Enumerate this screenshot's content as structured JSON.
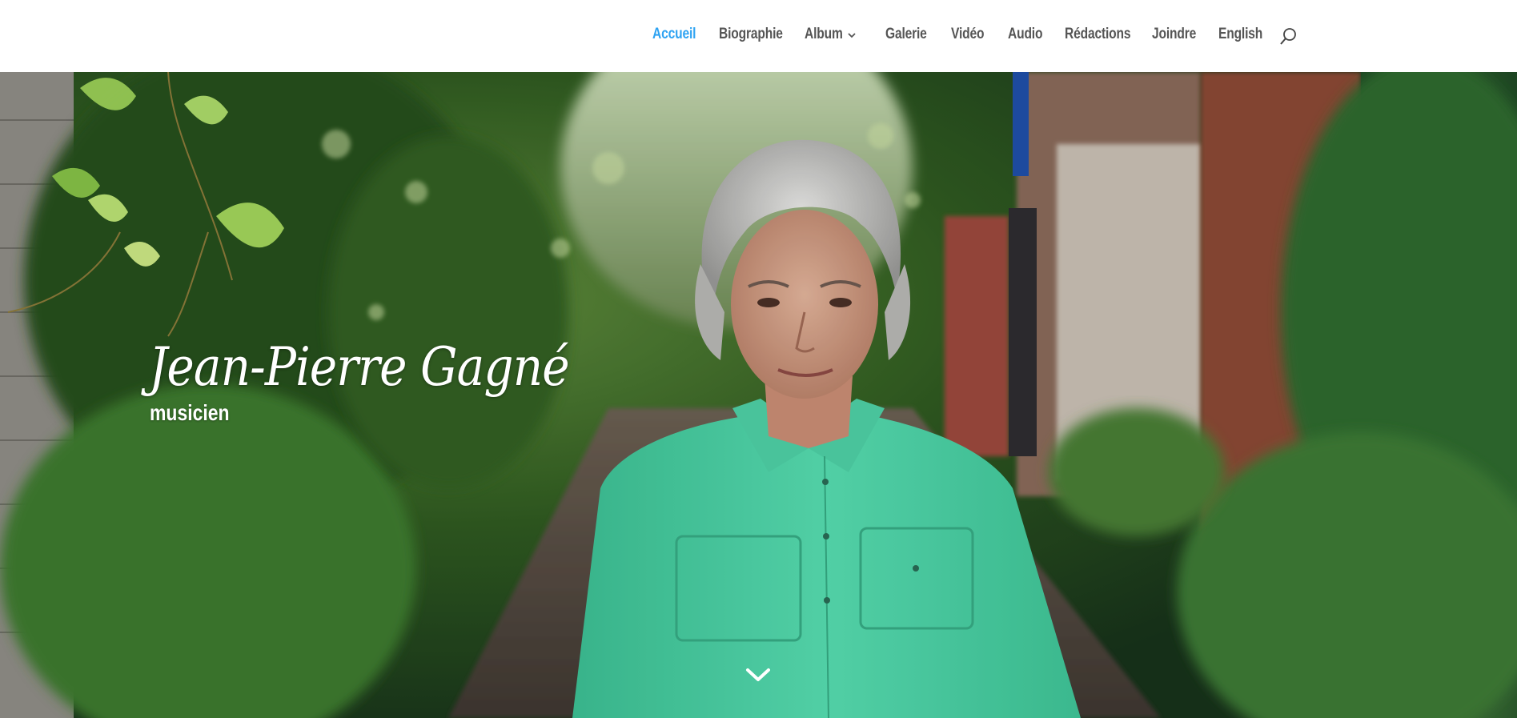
{
  "nav": {
    "items": [
      {
        "label": "Accueil",
        "active": true
      },
      {
        "label": "Biographie"
      },
      {
        "label": "Album",
        "has_dropdown": true
      },
      {
        "label": "Galerie"
      },
      {
        "label": "Vidéo"
      },
      {
        "label": "Audio"
      },
      {
        "label": "Rédactions"
      },
      {
        "label": "Joindre"
      },
      {
        "label": "English"
      }
    ],
    "search_icon": "search-icon",
    "dropdown_icon": "chevron-down-icon"
  },
  "hero": {
    "title": "Jean-Pierre Gagné",
    "subtitle": "musicien",
    "scroll_icon": "chevron-down-icon"
  },
  "colors": {
    "accent": "#2ea3f2",
    "nav_text": "#555555",
    "shirt": "#4fd6a9",
    "foliage": "#3f6b2c"
  }
}
